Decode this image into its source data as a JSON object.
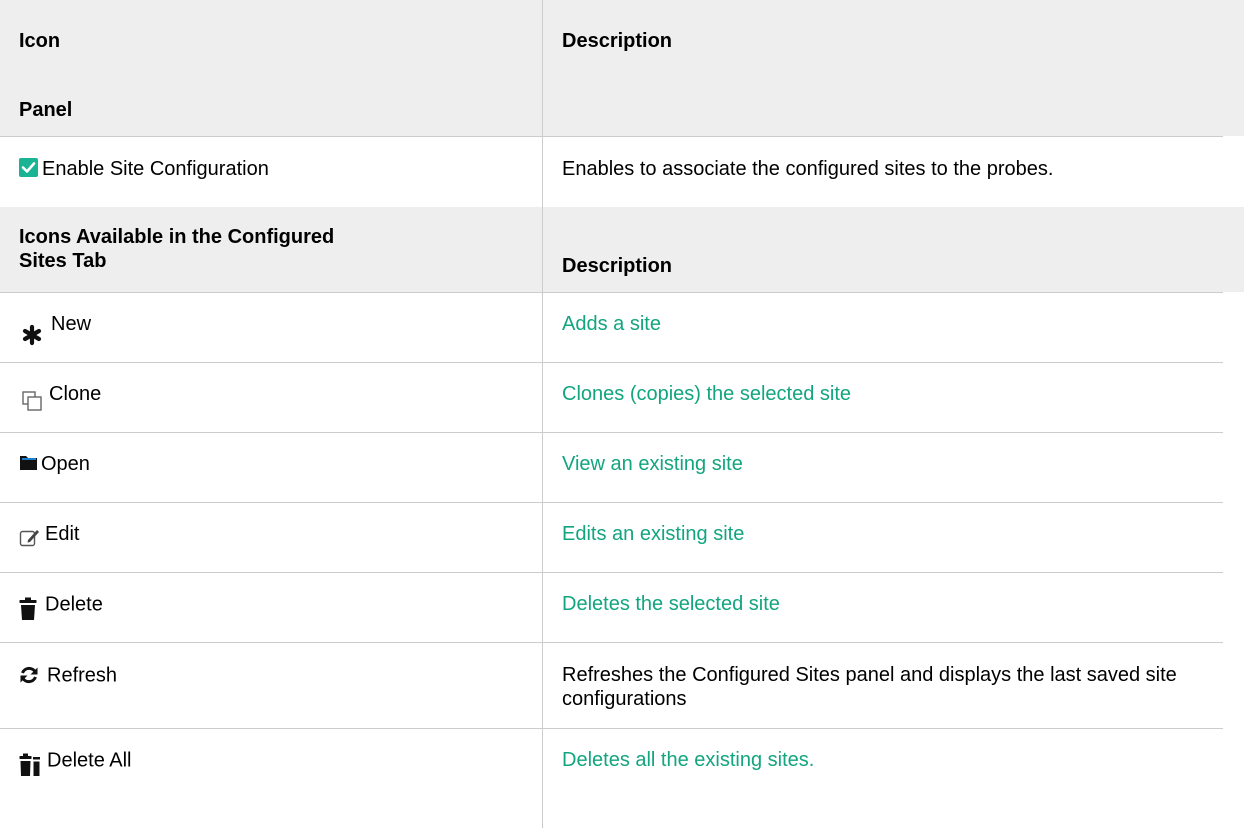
{
  "header": {
    "col1": "Icon",
    "col2": "Description"
  },
  "panel": {
    "label": "Panel"
  },
  "enable_row": {
    "label": "Enable Site Configuration",
    "description": "Enables to associate the configured sites to the probes."
  },
  "sub_header": {
    "col1": "Icons Available in the Configured Sites Tab",
    "col2": "Description"
  },
  "rows": [
    {
      "icon": "asterisk-icon",
      "label": "New",
      "description": "Adds a site"
    },
    {
      "icon": "clone-icon",
      "label": "Clone",
      "description": "Clones (copies) the selected site"
    },
    {
      "icon": "folder-icon",
      "label": "Open",
      "description": "View an existing site"
    },
    {
      "icon": "edit-icon",
      "label": "Edit",
      "description": "Edits an existing site"
    },
    {
      "icon": "trash-icon",
      "label": "Delete",
      "description": "Deletes the selected site"
    },
    {
      "icon": "refresh-icon",
      "label": "Refresh",
      "description": "Refreshes the Configured Sites panel and displays the last saved site configurations"
    },
    {
      "icon": "delete-all-icon",
      "label": "Delete All",
      "description": "Deletes all the existing sites."
    }
  ],
  "colors": {
    "header_bg": "#eeeeee",
    "border": "#cccccc",
    "link": "#12a57f",
    "checkbox": "#1ab394"
  }
}
